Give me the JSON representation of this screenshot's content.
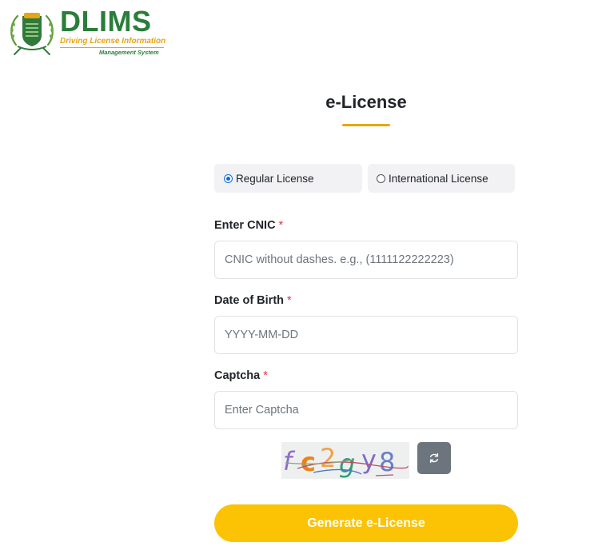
{
  "logo": {
    "title": "DLIMS",
    "subtitle_line1": "Driving License Information",
    "subtitle_line2": "Management System"
  },
  "page": {
    "title": "e-License",
    "accent_color": "#e6a90c"
  },
  "license_type": {
    "options": [
      {
        "label": "Regular License",
        "selected": true
      },
      {
        "label": "International License",
        "selected": false
      }
    ]
  },
  "form": {
    "cnic": {
      "label": "Enter CNIC",
      "required_mark": "*",
      "placeholder": "CNIC without dashes. e.g., (1111122222223)",
      "value": ""
    },
    "dob": {
      "label": "Date of Birth",
      "required_mark": "*",
      "placeholder": "YYYY-MM-DD",
      "value": ""
    },
    "captcha": {
      "label": "Captcha",
      "required_mark": "*",
      "placeholder": "Enter Captcha",
      "value": "",
      "image_text": "fc2gy8"
    },
    "refresh_icon": "refresh-icon",
    "submit_label": "Generate e-License",
    "submit_color": "#fbc304"
  }
}
